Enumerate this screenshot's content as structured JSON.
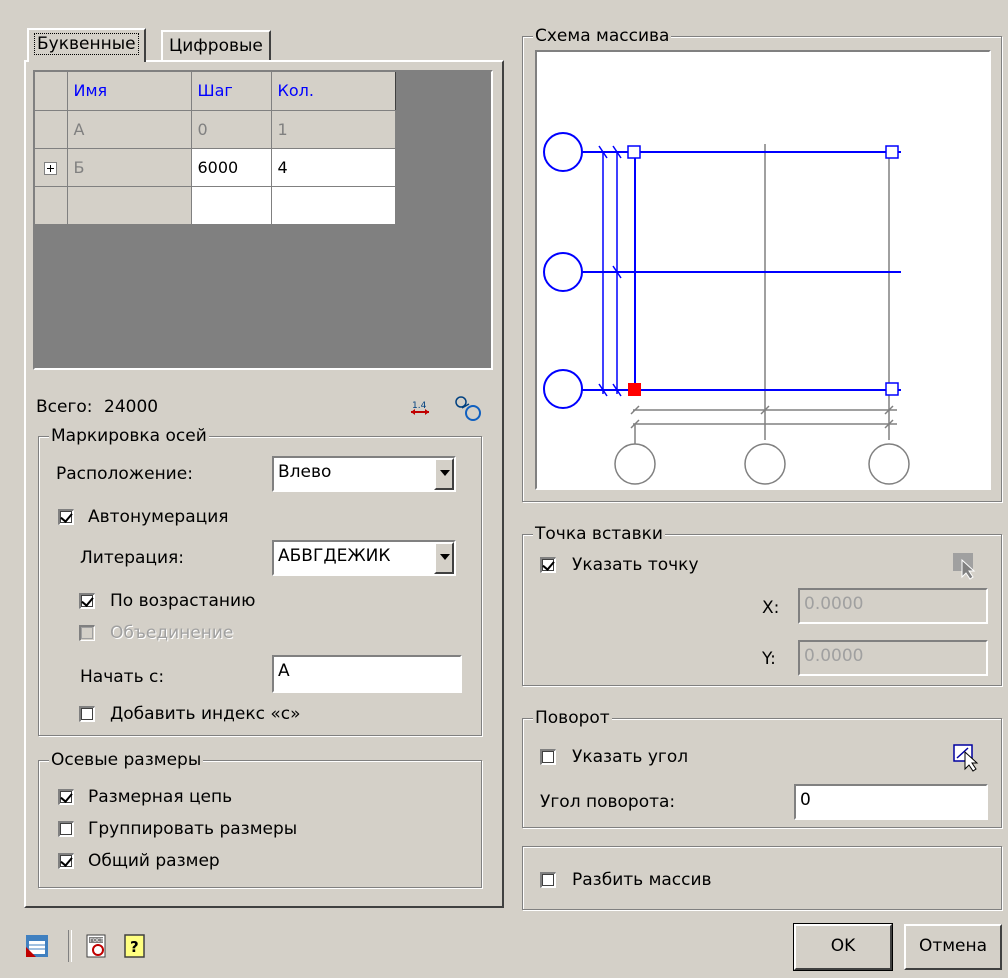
{
  "tabs": [
    {
      "label": "Буквенные",
      "active": true
    },
    {
      "label": "Цифровые",
      "active": false
    }
  ],
  "table": {
    "headers": [
      "Имя",
      "Шаг",
      "Кол."
    ],
    "rows": [
      {
        "expand": "",
        "name": "А",
        "step": "0",
        "count": "1",
        "dim": true
      },
      {
        "expand": "+",
        "name": "Б",
        "step": "6000",
        "count": "4",
        "dim": false
      },
      {
        "expand": "",
        "name": "",
        "step": "",
        "count": "",
        "dim": false
      }
    ]
  },
  "total": {
    "label": "Всего:",
    "value": "24000"
  },
  "total_icons": [
    "swap-axes-icon",
    "link-icon"
  ],
  "axis_marking": {
    "title": "Маркировка осей",
    "placement_label": "Расположение:",
    "placement_value": "Влево",
    "autonumber": {
      "label": "Автонумерация",
      "checked": true
    },
    "literation_label": "Литерация:",
    "literation_value": "АБВГДЕЖИК",
    "ascending": {
      "label": "По возрастанию",
      "checked": true
    },
    "merge": {
      "label": "Объединение",
      "checked": false,
      "disabled": true
    },
    "start_label": "Начать с:",
    "start_value": "А",
    "add_index": {
      "label": "Добавить индекс «с»",
      "checked": false
    }
  },
  "axis_dims": {
    "title": "Осевые размеры",
    "chain": {
      "label": "Размерная цепь",
      "checked": true
    },
    "group": {
      "label": "Группировать размеры",
      "checked": false
    },
    "overall": {
      "label": "Общий размер",
      "checked": true
    }
  },
  "scheme": {
    "title": "Схема массива"
  },
  "insert_point": {
    "title": "Точка вставки",
    "specify": {
      "label": "Указать точку",
      "checked": true
    },
    "x_label": "X:",
    "x_value": "0.0000",
    "y_label": "Y:",
    "y_value": "0.0000"
  },
  "rotation": {
    "title": "Поворот",
    "specify": {
      "label": "Указать угол",
      "checked": false
    },
    "angle_label": "Угол поворота:",
    "angle_value": "0"
  },
  "explode": {
    "label": "Разбить массив",
    "checked": false
  },
  "buttons": {
    "ok": "OK",
    "cancel": "Отмена"
  },
  "colors": {
    "axis_blue": "#0000ff",
    "base_point": "#ff0000",
    "dialog_bg": "#d4d0c8"
  }
}
